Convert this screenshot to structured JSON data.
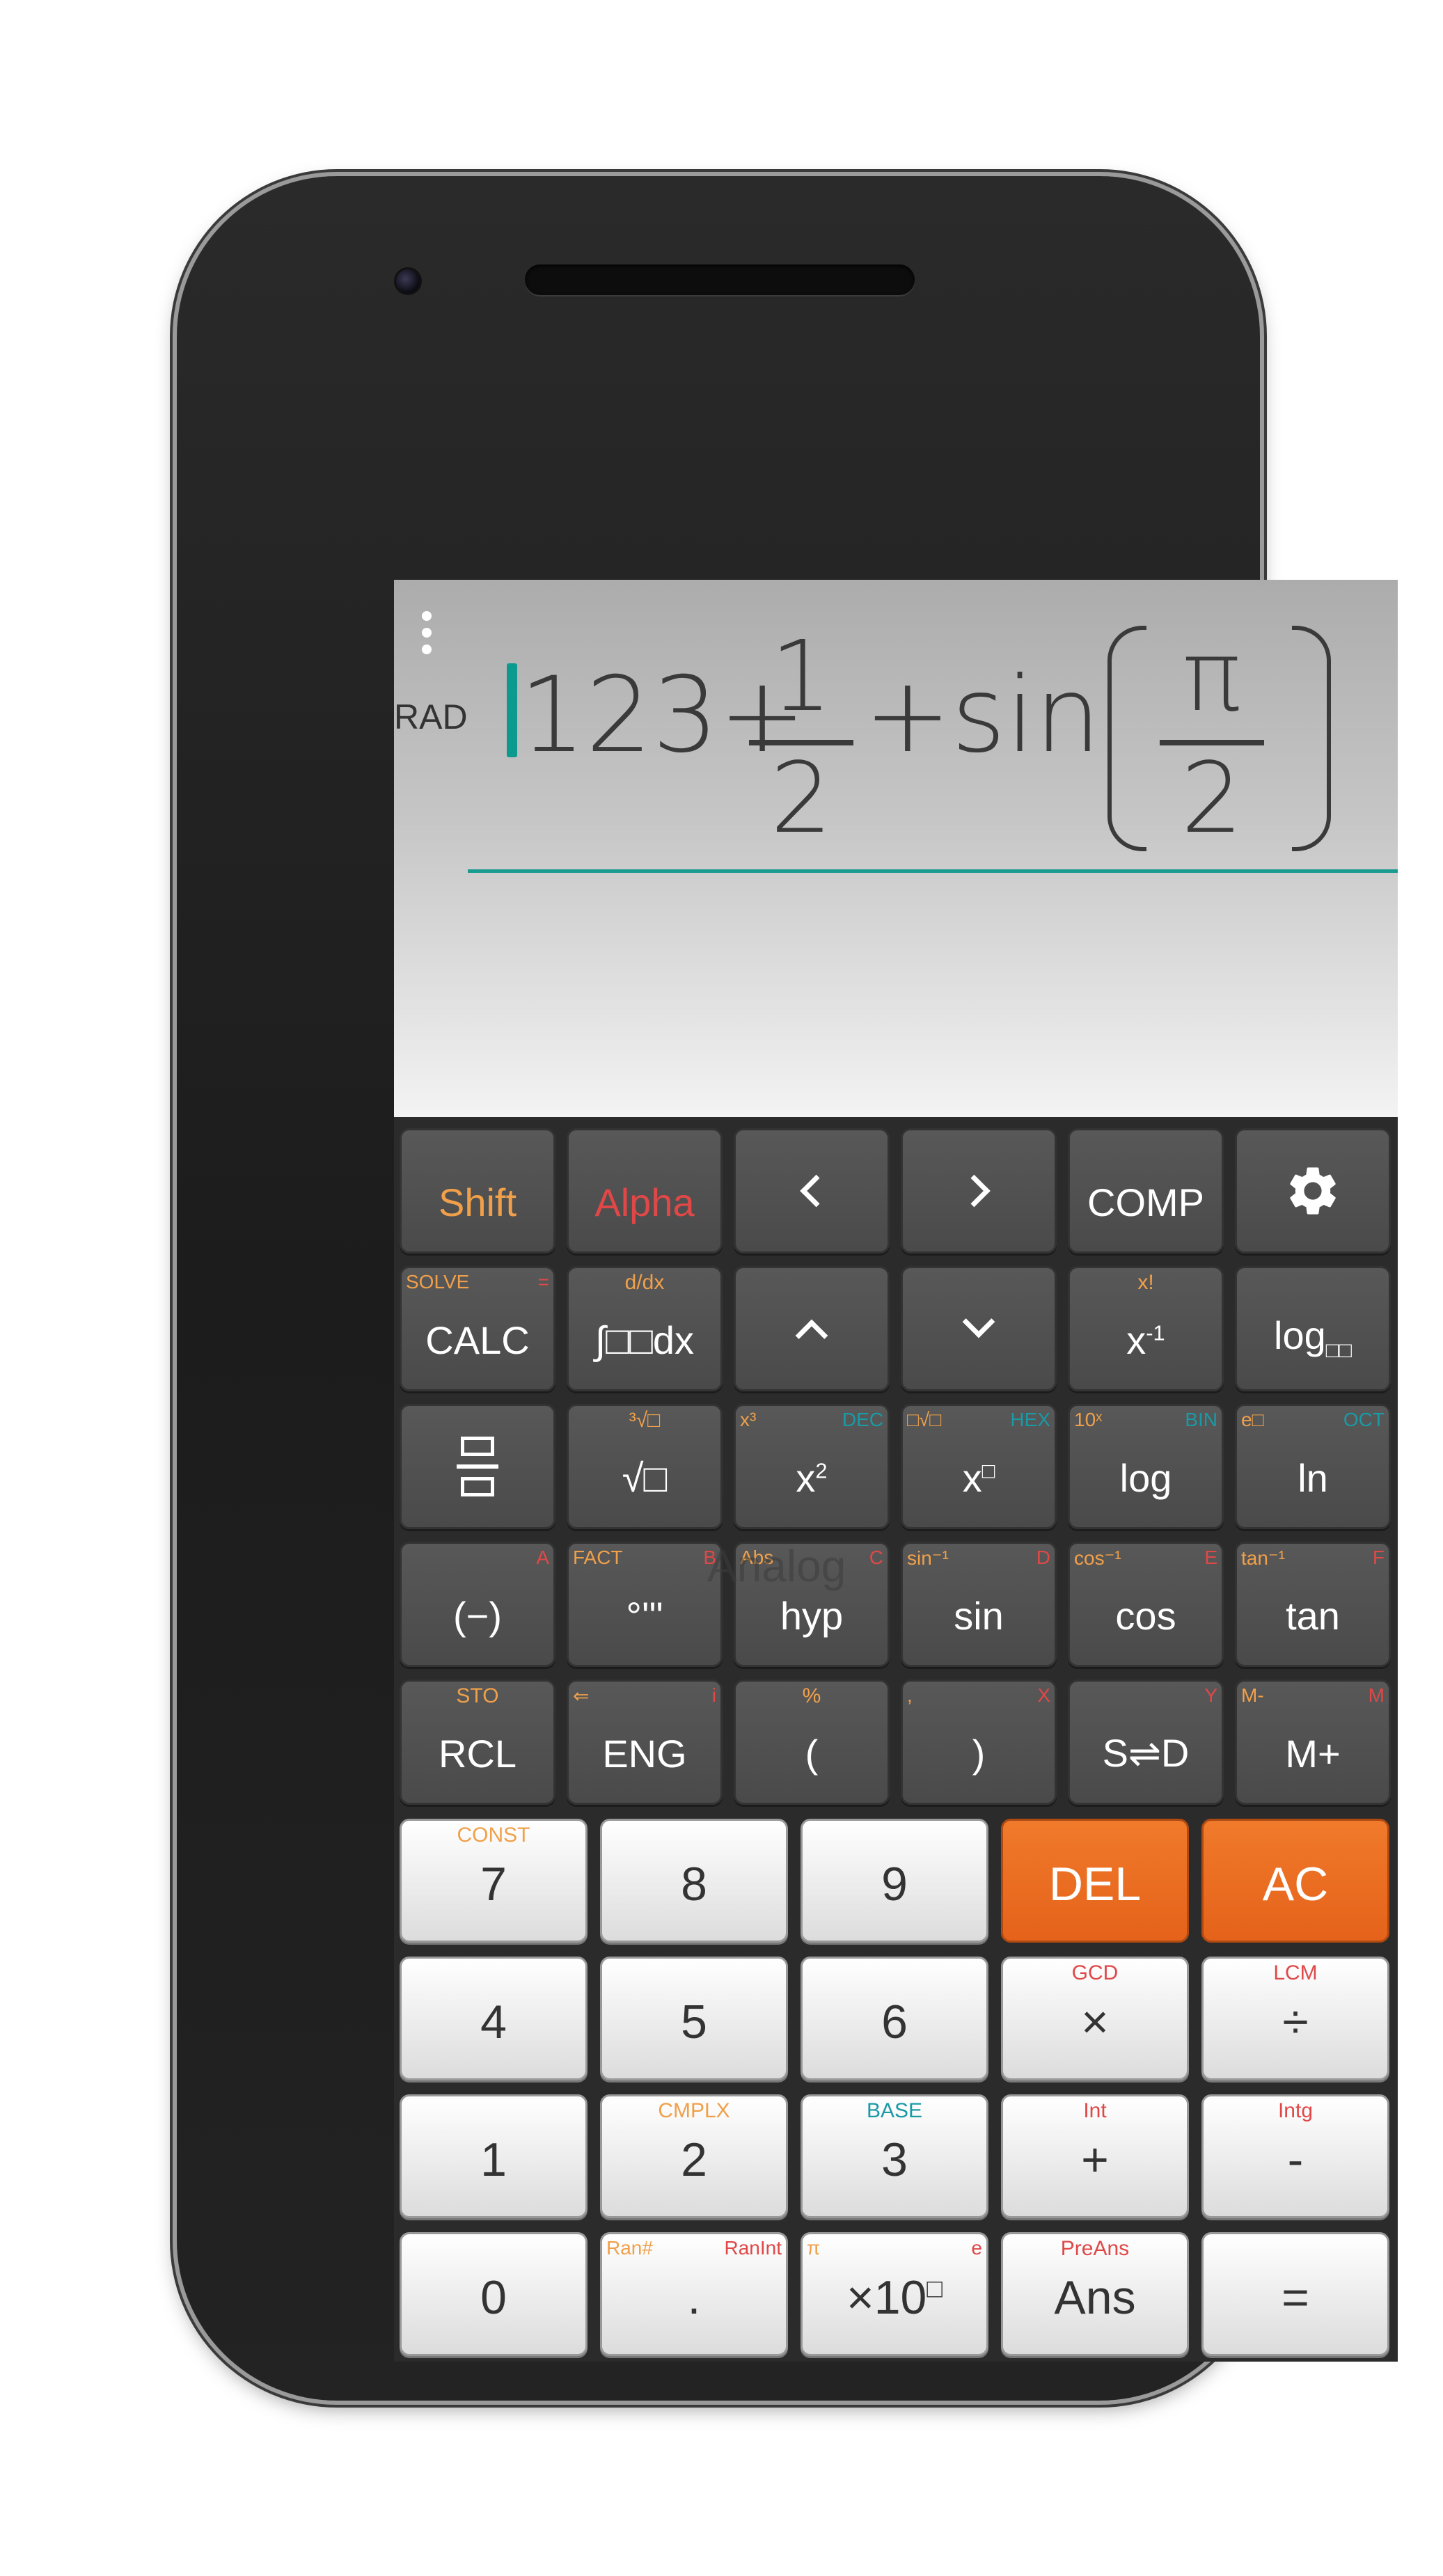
{
  "display": {
    "mode": "RAD",
    "expr_prefix": "123+",
    "frac1_num": "1",
    "frac1_den": "2",
    "expr_mid": "+sin",
    "frac2_num": "π",
    "frac2_den": "2"
  },
  "overlay": {
    "watermark": "Analog"
  },
  "keys": {
    "shift": "Shift",
    "alpha": "Alpha",
    "comp": "COMP",
    "calc": {
      "main": "CALC",
      "tl": "SOLVE",
      "tr": "="
    },
    "integral": {
      "main": "∫□□dx",
      "tc": "d/dx"
    },
    "inverse": {
      "main": "x",
      "sup": "-1",
      "tc": "x!"
    },
    "log_base": {
      "main": "log",
      "sub": "□□"
    },
    "sqrt": {
      "main": "√□",
      "tc": "³√□"
    },
    "square": {
      "main": "x",
      "sup": "2",
      "tl": "x³",
      "tr": "DEC"
    },
    "power": {
      "main": "x",
      "sup": "□",
      "tl": "□√□",
      "tr": "HEX"
    },
    "log": {
      "main": "log",
      "tl": "10ˣ",
      "tr": "BIN"
    },
    "ln": {
      "main": "ln",
      "tl": "e□",
      "tr": "OCT"
    },
    "neg": {
      "main": "(−)",
      "tr": "A"
    },
    "dms": {
      "main": "°'\"",
      "tl": "FACT",
      "tr": "B"
    },
    "hyp": {
      "main": "hyp",
      "tl": "Abs",
      "tr": "C"
    },
    "sin": {
      "main": "sin",
      "tl": "sin⁻¹",
      "tr": "D"
    },
    "cos": {
      "main": "cos",
      "tl": "cos⁻¹",
      "tr": "E"
    },
    "tan": {
      "main": "tan",
      "tl": "tan⁻¹",
      "tr": "F"
    },
    "rcl": {
      "main": "RCL",
      "tc": "STO"
    },
    "eng": {
      "main": "ENG",
      "tl": "⇐",
      "tr": "i"
    },
    "lparen": {
      "main": "(",
      "tc": "%"
    },
    "rparen": {
      "main": ")",
      "tl": ",",
      "tr": "X"
    },
    "sd": {
      "main": "S⇌D",
      "tr": "Y"
    },
    "mplus": {
      "main": "M+",
      "tl": "M-",
      "tr": "M"
    },
    "n7": {
      "main": "7",
      "tc": "CONST"
    },
    "n8": {
      "main": "8"
    },
    "n9": {
      "main": "9"
    },
    "del": {
      "main": "DEL"
    },
    "ac": {
      "main": "AC"
    },
    "n4": {
      "main": "4"
    },
    "n5": {
      "main": "5"
    },
    "n6": {
      "main": "6"
    },
    "mul": {
      "main": "×",
      "tc": "GCD"
    },
    "div": {
      "main": "÷",
      "tc": "LCM"
    },
    "n1": {
      "main": "1"
    },
    "n2": {
      "main": "2",
      "tc": "CMPLX"
    },
    "n3": {
      "main": "3",
      "tc": "BASE"
    },
    "plus": {
      "main": "+",
      "tc": "Int"
    },
    "minus": {
      "main": "-",
      "tc": "Intg"
    },
    "n0": {
      "main": "0"
    },
    "dot": {
      "main": ".",
      "tl": "Ran#",
      "tr": "RanInt"
    },
    "exp10": {
      "main": "×10",
      "sup": "□",
      "tl": "π",
      "tr": "e"
    },
    "ans": {
      "main": "Ans",
      "tc": "PreAns"
    },
    "equals": {
      "main": "="
    }
  },
  "colors": {
    "accent": "#0c9a8e",
    "shift": "#f0a04a",
    "alpha": "#e04848",
    "del_ac": "#e5621a"
  }
}
